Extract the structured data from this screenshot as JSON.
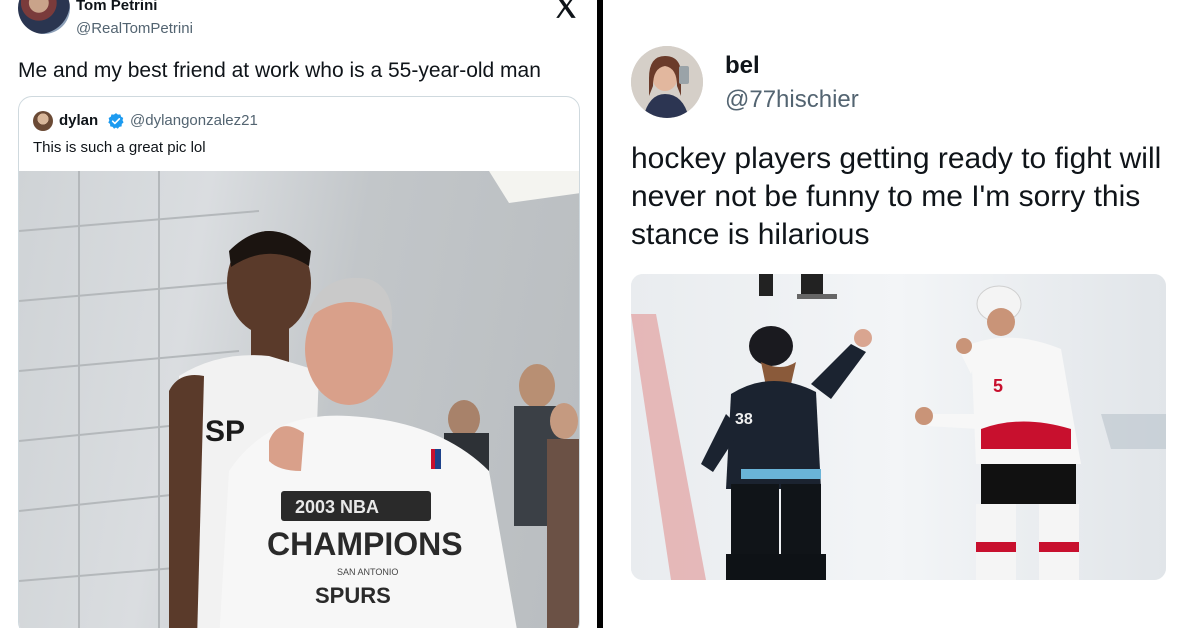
{
  "left_tweet": {
    "author_name": "Tom Petrini",
    "author_handle": "@RealTomPetrini",
    "text": "Me and my best friend at work who is a 55-year-old man",
    "platform_icon": "x-logo-icon",
    "quoted_tweet": {
      "author_name": "dylan",
      "verified_icon": "verified-badge-icon",
      "author_handle": "@dylangonzalez21",
      "text": "This is such a great pic lol",
      "photo": {
        "jersey_text": "SP",
        "shirt_line1": "2003 NBA",
        "shirt_line2": "CHAMPIONS",
        "shirt_line3": "SPURS",
        "shirt_line4": "SAN ANTONIO"
      }
    }
  },
  "right_tweet": {
    "author_name": "bel",
    "author_handle": "@77hischier",
    "text": "hockey players getting ready to fight will never not be funny to me I'm sorry this stance is hilarious",
    "photo": {
      "player_left_number": "38",
      "player_right_number": "5"
    }
  },
  "colors": {
    "text": "#0f1419",
    "secondary_text": "#536471",
    "verified_blue": "#1d9bf0",
    "divider": "#000000"
  }
}
